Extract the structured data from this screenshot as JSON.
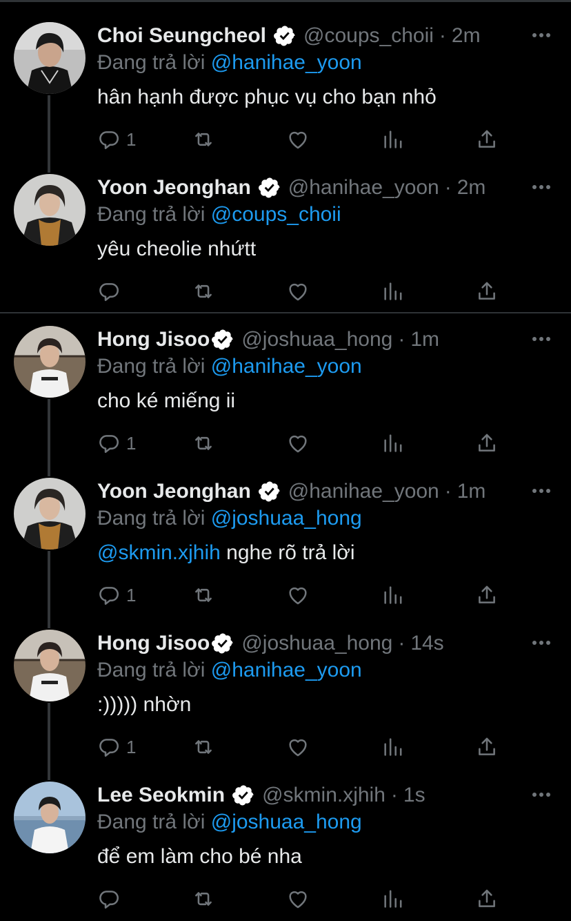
{
  "theme": {
    "background": "#000000",
    "text": "#e7e9ea",
    "muted": "#71767b",
    "accent": "#1d9bf0",
    "verified_badge": "#ffffff"
  },
  "tweets": [
    {
      "name": "Choi Seungcheol",
      "handle": "@coups_choii",
      "time": "2m",
      "reply_prefix": "Đang trả lời",
      "reply_to": "@hanihae_yoon",
      "text_mention": "",
      "text": "hân hạnh được phục vụ cho bạn nhỏ",
      "reply_count": "1"
    },
    {
      "name": "Yoon Jeonghan",
      "handle": "@hanihae_yoon",
      "time": "2m",
      "reply_prefix": "Đang trả lời",
      "reply_to": "@coups_choii",
      "text_mention": "",
      "text": "yêu cheolie nhứtt",
      "reply_count": ""
    },
    {
      "name": "Hong Jisoo",
      "handle": "@joshuaa_hong",
      "time": "1m",
      "reply_prefix": "Đang trả lời",
      "reply_to": "@hanihae_yoon",
      "text_mention": "",
      "text": "cho ké miếng ii",
      "reply_count": "1"
    },
    {
      "name": "Yoon Jeonghan",
      "handle": "@hanihae_yoon",
      "time": "1m",
      "reply_prefix": "Đang trả lời",
      "reply_to": "@joshuaa_hong",
      "text_mention": "@skmin.xjhih",
      "text": " nghe rõ trả lời",
      "reply_count": "1"
    },
    {
      "name": "Hong Jisoo",
      "handle": "@joshuaa_hong",
      "time": "14s",
      "reply_prefix": "Đang trả lời",
      "reply_to": "@hanihae_yoon",
      "text_mention": "",
      "text": ":))))) nhờn",
      "reply_count": "1"
    },
    {
      "name": "Lee Seokmin",
      "handle": "@skmin.xjhih",
      "time": "1s",
      "reply_prefix": "Đang trả lời",
      "reply_to": "@joshuaa_hong",
      "text_mention": "",
      "text": "để em làm cho bé nha",
      "reply_count": ""
    }
  ],
  "icons": {
    "reply": "reply-icon",
    "retweet": "retweet-icon",
    "like": "heart-icon",
    "views": "views-icon",
    "share": "share-icon",
    "more": "more-icon",
    "verified": "verified-badge-icon"
  }
}
